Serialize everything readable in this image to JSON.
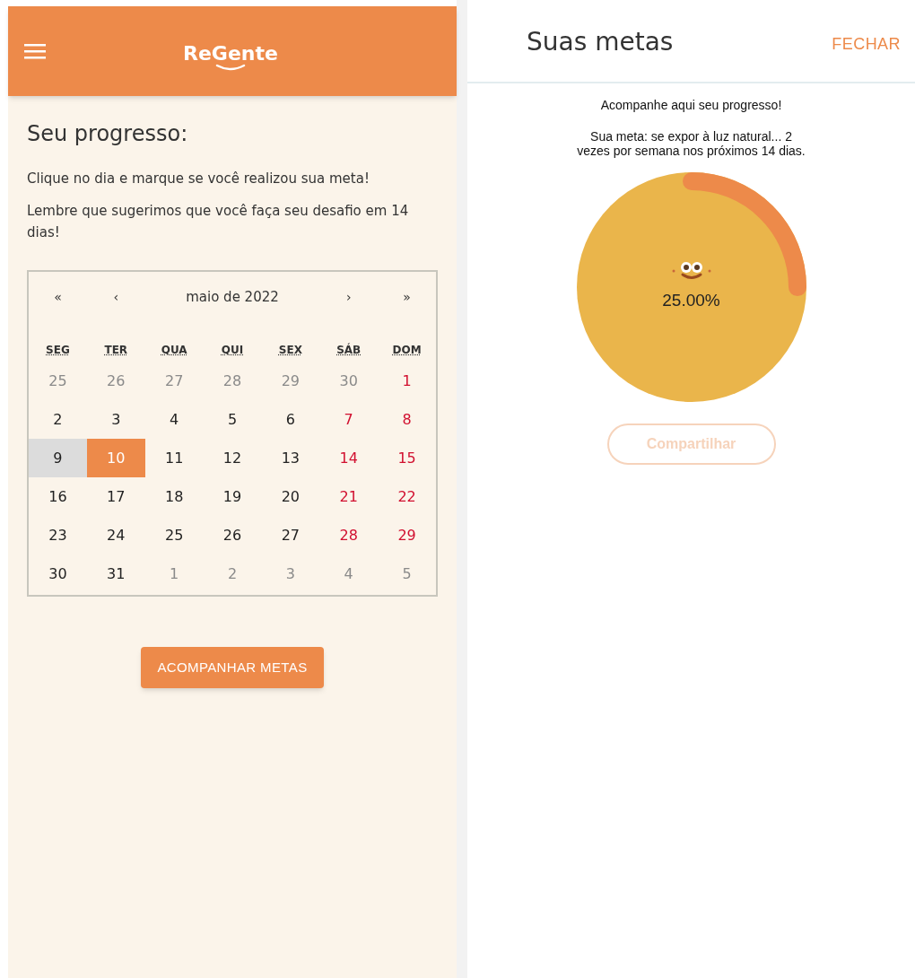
{
  "header": {
    "logo": "ReGente"
  },
  "progress": {
    "title": "Seu progresso:",
    "instructions": [
      "Clique no dia e marque se você realizou sua meta!",
      "Lembre que sugerimos que você faça seu desafio em 14 dias!"
    ]
  },
  "calendar": {
    "nav": [
      "«",
      "‹",
      "›",
      "»"
    ],
    "month": "maio de 2022",
    "weekdays": [
      "SEG",
      "TER",
      "QUA",
      "QUI",
      "SEX",
      "SÁB",
      "DOM"
    ],
    "weeks": [
      [
        {
          "label": "25",
          "kind": "outside",
          "selected": false,
          "today": false
        },
        {
          "label": "26",
          "kind": "outside",
          "selected": false,
          "today": false
        },
        {
          "label": "27",
          "kind": "outside",
          "selected": false,
          "today": false
        },
        {
          "label": "28",
          "kind": "outside",
          "selected": false,
          "today": false
        },
        {
          "label": "29",
          "kind": "outside",
          "selected": false,
          "today": false
        },
        {
          "label": "30",
          "kind": "outside",
          "selected": false,
          "today": false
        },
        {
          "label": "1",
          "kind": "weekend",
          "selected": false,
          "today": false
        }
      ],
      [
        {
          "label": "2",
          "kind": "weekday",
          "selected": false,
          "today": false
        },
        {
          "label": "3",
          "kind": "weekday",
          "selected": false,
          "today": false
        },
        {
          "label": "4",
          "kind": "weekday",
          "selected": false,
          "today": false
        },
        {
          "label": "5",
          "kind": "weekday",
          "selected": false,
          "today": false
        },
        {
          "label": "6",
          "kind": "weekday",
          "selected": false,
          "today": false
        },
        {
          "label": "7",
          "kind": "weekend",
          "selected": false,
          "today": false
        },
        {
          "label": "8",
          "kind": "weekend",
          "selected": false,
          "today": false
        }
      ],
      [
        {
          "label": "9",
          "kind": "weekday",
          "selected": false,
          "today": true
        },
        {
          "label": "10",
          "kind": "weekday",
          "selected": true,
          "today": false
        },
        {
          "label": "11",
          "kind": "weekday",
          "selected": false,
          "today": false
        },
        {
          "label": "12",
          "kind": "weekday",
          "selected": false,
          "today": false
        },
        {
          "label": "13",
          "kind": "weekday",
          "selected": false,
          "today": false
        },
        {
          "label": "14",
          "kind": "weekend",
          "selected": false,
          "today": false
        },
        {
          "label": "15",
          "kind": "weekend",
          "selected": false,
          "today": false
        }
      ],
      [
        {
          "label": "16",
          "kind": "weekday",
          "selected": false,
          "today": false
        },
        {
          "label": "17",
          "kind": "weekday",
          "selected": false,
          "today": false
        },
        {
          "label": "18",
          "kind": "weekday",
          "selected": false,
          "today": false
        },
        {
          "label": "19",
          "kind": "weekday",
          "selected": false,
          "today": false
        },
        {
          "label": "20",
          "kind": "weekday",
          "selected": false,
          "today": false
        },
        {
          "label": "21",
          "kind": "weekend",
          "selected": false,
          "today": false
        },
        {
          "label": "22",
          "kind": "weekend",
          "selected": false,
          "today": false
        }
      ],
      [
        {
          "label": "23",
          "kind": "weekday",
          "selected": false,
          "today": false
        },
        {
          "label": "24",
          "kind": "weekday",
          "selected": false,
          "today": false
        },
        {
          "label": "25",
          "kind": "weekday",
          "selected": false,
          "today": false
        },
        {
          "label": "26",
          "kind": "weekday",
          "selected": false,
          "today": false
        },
        {
          "label": "27",
          "kind": "weekday",
          "selected": false,
          "today": false
        },
        {
          "label": "28",
          "kind": "weekend",
          "selected": false,
          "today": false
        },
        {
          "label": "29",
          "kind": "weekend",
          "selected": false,
          "today": false
        }
      ],
      [
        {
          "label": "30",
          "kind": "weekday",
          "selected": false,
          "today": false
        },
        {
          "label": "31",
          "kind": "weekday",
          "selected": false,
          "today": false
        },
        {
          "label": "1",
          "kind": "outside",
          "selected": false,
          "today": false
        },
        {
          "label": "2",
          "kind": "outside",
          "selected": false,
          "today": false
        },
        {
          "label": "3",
          "kind": "outside",
          "selected": false,
          "today": false
        },
        {
          "label": "4",
          "kind": "outside",
          "selected": false,
          "today": false
        },
        {
          "label": "5",
          "kind": "outside",
          "selected": false,
          "today": false
        }
      ]
    ]
  },
  "track_button": {
    "label": "ACOMPANHAR METAS"
  },
  "goals_panel": {
    "title": "Suas metas",
    "close": "FECHAR",
    "intro": "Acompanhe aqui seu progresso!",
    "goal": "Sua meta: se expor à luz natural... 2 vezes por semana nos próximos 14 dias.",
    "progress": {
      "reading": "25.00%"
    },
    "share": {
      "label": "Compartilhar",
      "disabled": true
    }
  }
}
